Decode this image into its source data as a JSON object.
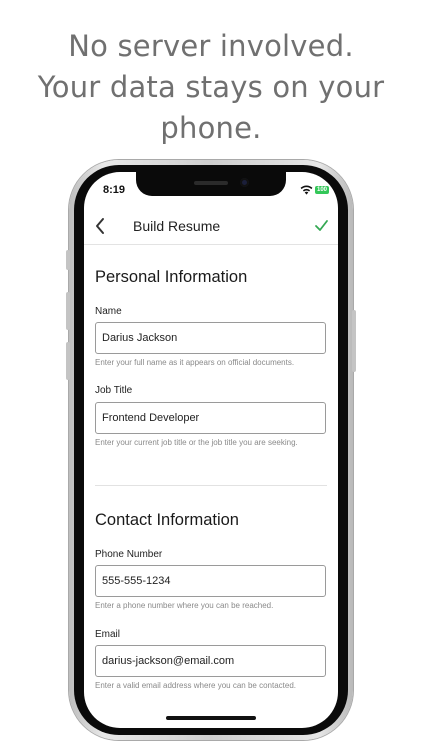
{
  "promo": {
    "line1": "No server involved.",
    "line2": "Your data stays on your",
    "line3": "phone."
  },
  "status_bar": {
    "time": "8:19",
    "battery_level": "100",
    "icons": [
      "wifi-icon",
      "battery-icon"
    ]
  },
  "nav": {
    "title": "Build Resume",
    "back_icon": "chevron-left-icon",
    "confirm_icon": "checkmark-icon",
    "accent_color": "#34a853"
  },
  "personal": {
    "title": "Personal Information",
    "name": {
      "label": "Name",
      "value": "Darius Jackson",
      "hint": "Enter your full name as it appears on official documents."
    },
    "job_title": {
      "label": "Job Title",
      "value": "Frontend Developer",
      "hint": "Enter your current job title or the job title you are seeking."
    }
  },
  "contact": {
    "title": "Contact Information",
    "phone": {
      "label": "Phone Number",
      "value": "555-555-1234",
      "hint": "Enter a phone number where you can be reached."
    },
    "email": {
      "label": "Email",
      "value": "darius-jackson@email.com",
      "hint": "Enter a valid email address where you can be contacted."
    }
  }
}
